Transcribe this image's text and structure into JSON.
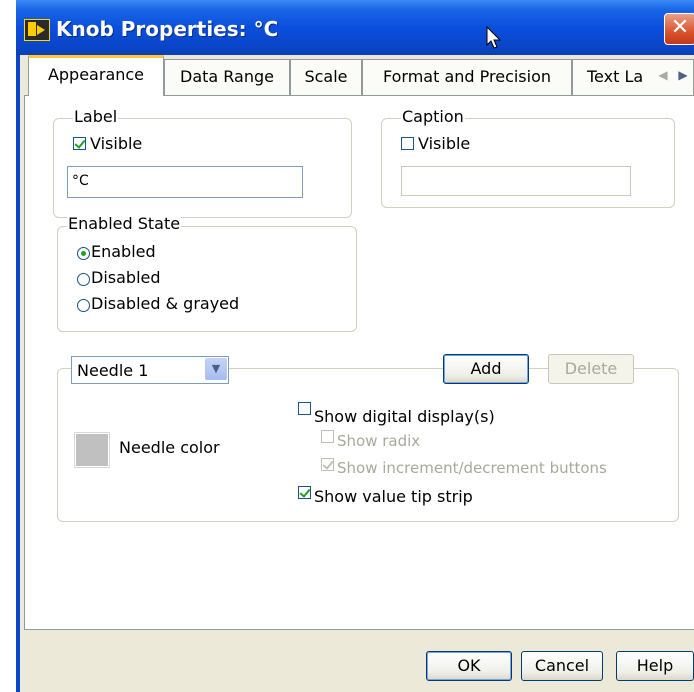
{
  "window": {
    "title": "Knob Properties: °C",
    "close_glyph": "✕"
  },
  "tabs": [
    {
      "label": "Appearance",
      "active": true
    },
    {
      "label": "Data Range"
    },
    {
      "label": "Scale"
    },
    {
      "label": "Format and Precision"
    },
    {
      "label": "Text La"
    }
  ],
  "tab_scroll": {
    "left": "◀",
    "right": "▶"
  },
  "label_group": {
    "legend": "Label",
    "visible_label": "Visible",
    "visible_checked": true,
    "value": "°C"
  },
  "caption_group": {
    "legend": "Caption",
    "visible_label": "Visible",
    "visible_checked": false,
    "value": ""
  },
  "enabled_state": {
    "legend": "Enabled State",
    "options": [
      {
        "label": "Enabled",
        "selected": true
      },
      {
        "label": "Disabled",
        "selected": false
      },
      {
        "label": "Disabled & grayed",
        "selected": false
      }
    ]
  },
  "needle": {
    "selected": "Needle 1",
    "add_label": "Add",
    "delete_label": "Delete",
    "color_label": "Needle color",
    "color": "#c0c0c0",
    "show_digital_display": {
      "label": "Show digital display(s)",
      "checked": false
    },
    "show_radix": {
      "label": "Show radix",
      "checked": false
    },
    "show_incdec": {
      "label": "Show increment/decrement buttons",
      "checked": true
    },
    "show_value_tip": {
      "label": "Show value tip strip",
      "checked": true
    }
  },
  "footer": {
    "ok_label": "OK",
    "cancel_label": "Cancel",
    "help_label": "Help"
  },
  "colors": {
    "titlebar": "#0a4fdc",
    "dialog_bg": "#ece9d8",
    "active_tab_accent": "#ffc83c"
  }
}
